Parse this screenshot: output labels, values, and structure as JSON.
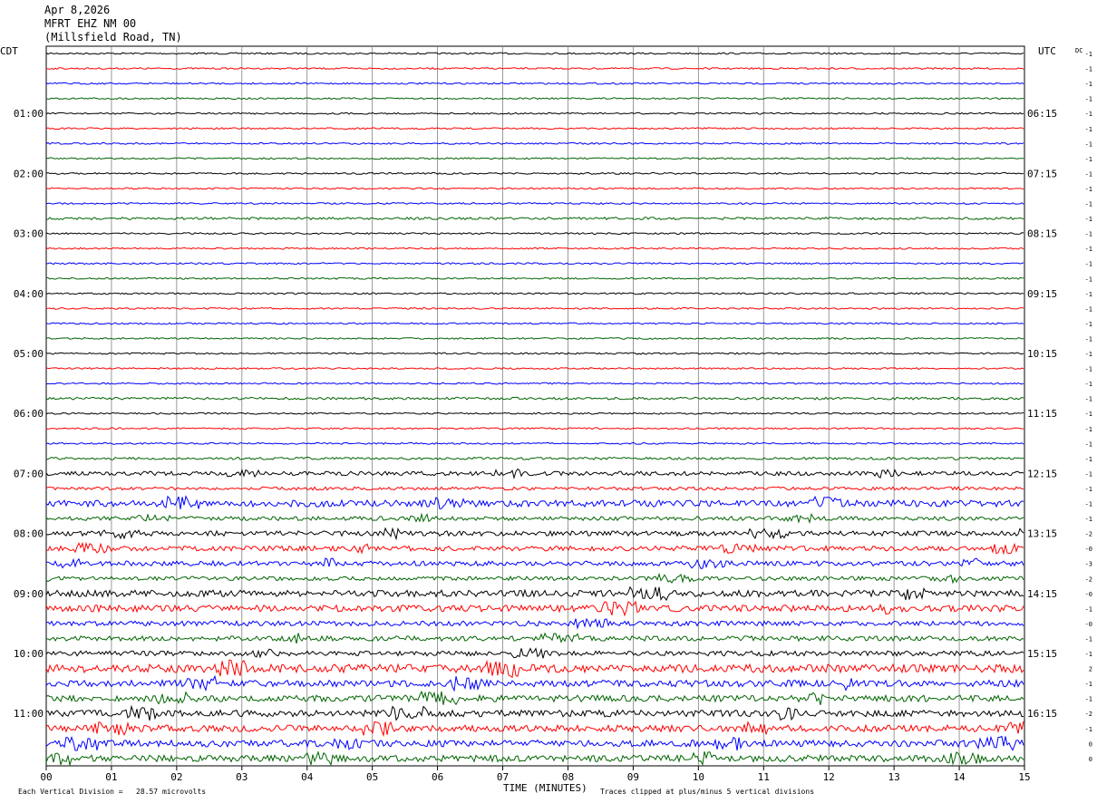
{
  "header": {
    "date": "Apr 8,2026",
    "station": "MFRT EHZ NM 00",
    "location": "(Millsfield Road, TN)"
  },
  "left_axis_title": "CDT",
  "right_axis_title": "UTC",
  "dc_title": "DC",
  "x_axis_title": "TIME (MINUTES)",
  "footer": {
    "scale_note": "Each Vertical Division =   28.57 microvolts",
    "clip_note": "Traces clipped at plus/minus 5 vertical divisions"
  },
  "colors": {
    "trace_cycle": [
      "#000000",
      "#ff0000",
      "#0000ff",
      "#006400"
    ],
    "grid": "#808080"
  },
  "chart_data": {
    "type": "line",
    "title": "",
    "xlabel": "TIME (MINUTES)",
    "ylabel": "",
    "xlim": [
      0,
      15
    ],
    "x_ticks": [
      "00",
      "01",
      "02",
      "03",
      "04",
      "05",
      "06",
      "07",
      "08",
      "09",
      "10",
      "11",
      "12",
      "13",
      "14",
      "15"
    ],
    "trace_count": 48,
    "left_time_labels": [
      "01:00",
      "02:00",
      "03:00",
      "04:00",
      "05:00",
      "06:00",
      "07:00",
      "08:00",
      "09:00",
      "10:00",
      "11:00"
    ],
    "right_time_labels": [
      "06:15",
      "07:15",
      "08:15",
      "09:15",
      "10:15",
      "11:15",
      "12:15",
      "13:15",
      "14:15",
      "15:15",
      "16:15"
    ],
    "dc_offsets": [
      "-1",
      "-1",
      "-1",
      "-1",
      "-1",
      "-1",
      "-1",
      "-1",
      "-1",
      "-1",
      "-1",
      "-1",
      "-1",
      "-1",
      "-1",
      "-1",
      "-1",
      "-1",
      "-1",
      "-1",
      "-1",
      "-1",
      "-1",
      "-1",
      "-1",
      "-1",
      "-1",
      "-1",
      "-1",
      "-1",
      "-1",
      "-1",
      "-2",
      "-0",
      "-3",
      "-2",
      "-0",
      "-1",
      "-0",
      "-1",
      "-1",
      "2",
      "-1",
      "-1",
      "-2",
      "-1",
      "0",
      "0",
      "-1",
      "-1",
      "-1",
      "-1"
    ],
    "activity_level": [
      1,
      1,
      1,
      1,
      1,
      1,
      1,
      1,
      1,
      1,
      1,
      1.5,
      1,
      1,
      1,
      1,
      1,
      1,
      1,
      1,
      1,
      1,
      1,
      1.5,
      1,
      1,
      1,
      1.5,
      2.5,
      2,
      4,
      2.5,
      3,
      3,
      3,
      2.5,
      4,
      4,
      3,
      3,
      3,
      5,
      4,
      4,
      4,
      4,
      4,
      4,
      4
    ]
  }
}
